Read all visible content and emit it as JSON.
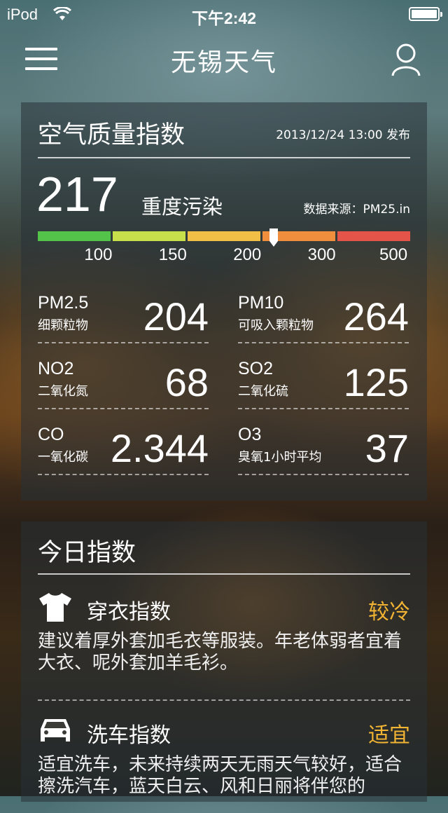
{
  "status_bar": {
    "carrier": "iPod",
    "time": "下午2:42"
  },
  "nav": {
    "title": "无锡天气",
    "menu_icon": "hamburger-icon",
    "user_icon": "user-icon"
  },
  "aqi": {
    "title": "空气质量指数",
    "published": "2013/12/24 13:00 发布",
    "value": "217",
    "level": "重度污染",
    "source": "数据来源：PM25.in",
    "scale_colors": [
      "#53c34a",
      "#c6df4a",
      "#f1bf45",
      "#ef8e3c",
      "#e45449"
    ],
    "scale_labels": [
      "100",
      "150",
      "200",
      "300",
      "500"
    ],
    "marker_value": 217,
    "pollutants": [
      {
        "name": "PM2.5",
        "cn": "细颗粒物",
        "value": "204"
      },
      {
        "name": "PM10",
        "cn": "可吸入颗粒物",
        "value": "264"
      },
      {
        "name": "NO2",
        "cn": "二氧化氮",
        "value": "68"
      },
      {
        "name": "SO2",
        "cn": "二氧化硫",
        "value": "125"
      },
      {
        "name": "CO",
        "cn": "一氧化碳",
        "value": "2.344"
      },
      {
        "name": "O3",
        "cn": "臭氧1小时平均",
        "value": "37"
      }
    ]
  },
  "today": {
    "title": "今日指数",
    "items": [
      {
        "icon": "tshirt-icon",
        "name": "穿衣指数",
        "level": "较冷",
        "desc": "建议着厚外套加毛衣等服装。年老体弱者宜着大衣、呢外套加羊毛衫。"
      },
      {
        "icon": "car-icon",
        "name": "洗车指数",
        "level": "适宜",
        "desc": "适宜洗车，未来持续两天无雨天气较好，适合擦洗汽车，蓝天白云、风和日丽将伴您的"
      }
    ],
    "accent": "#f2b433"
  }
}
